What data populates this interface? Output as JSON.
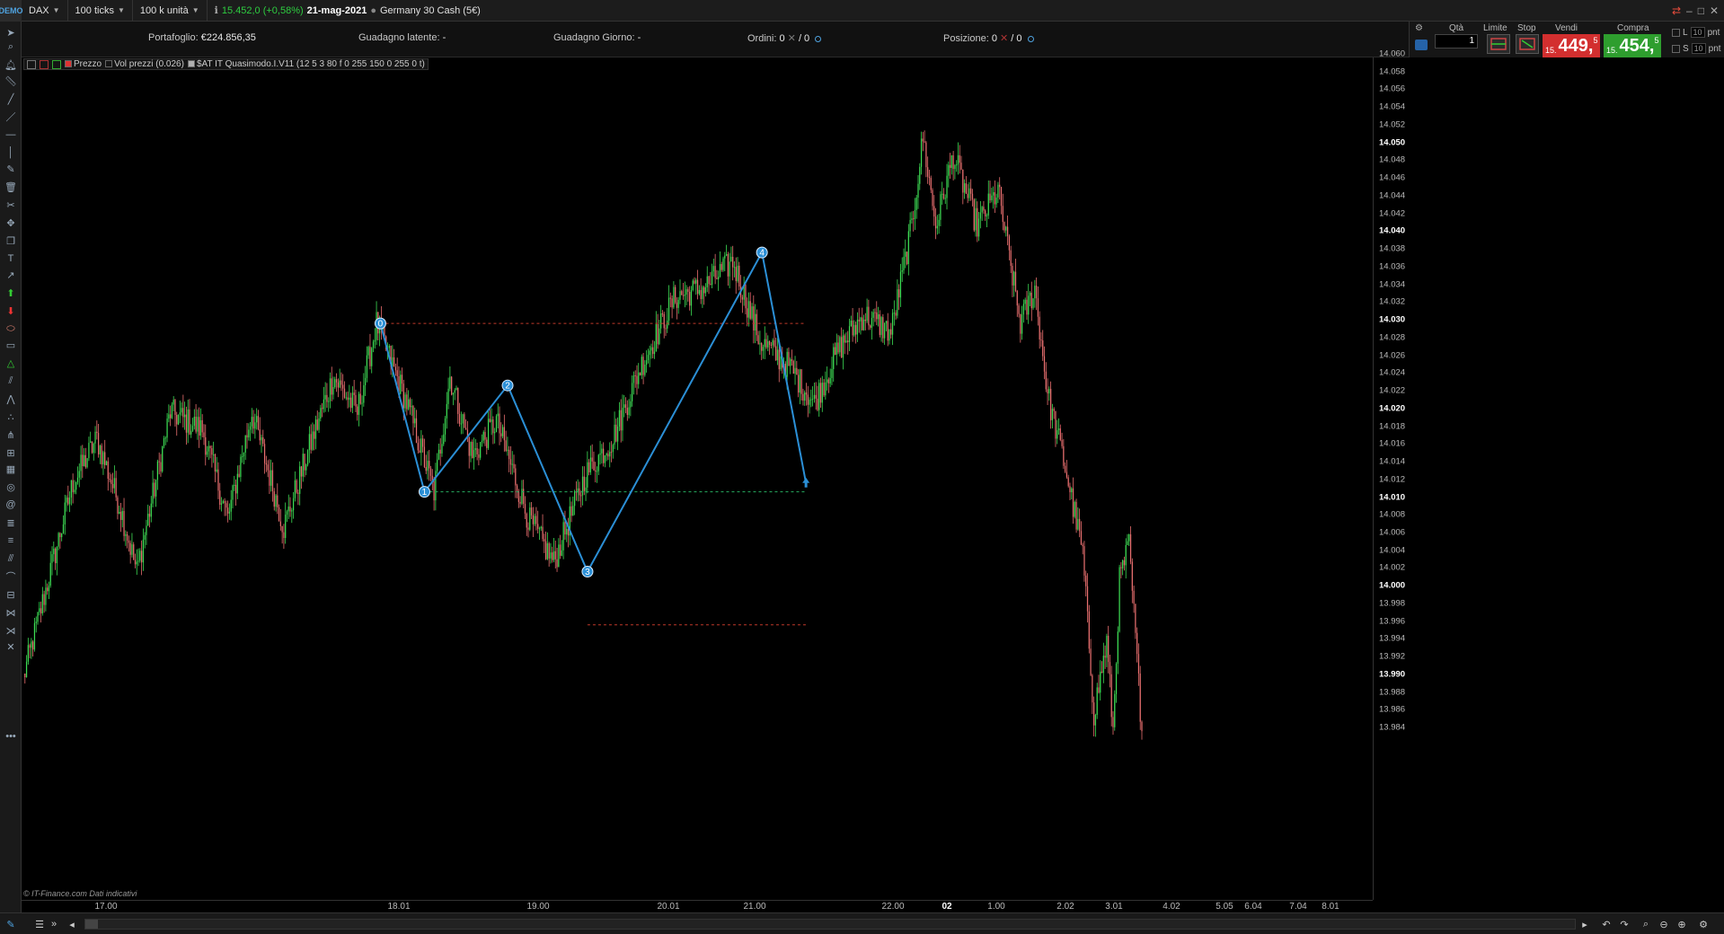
{
  "topbar": {
    "logo": "DEMO",
    "instrument": "DAX",
    "ticks": "100 ticks",
    "units": "100 k unità",
    "price_change": "15.452,0 (+0,58%)",
    "date": "21-mag-2021",
    "market": "Germany 30 Cash (5€)"
  },
  "info": {
    "portfolio_label": "Portafoglio:",
    "portfolio_value": "€224.856,35",
    "unrealized_label": "Guadagno latente:",
    "unrealized_value": "-",
    "daygain_label": "Guadagno Giorno:",
    "daygain_value": "-",
    "orders_label": "Ordini:",
    "orders_value_a": "0",
    "orders_value_b": "/ 0",
    "position_label": "Posizione:",
    "position_value_a": "0",
    "position_value_b": "/ 0"
  },
  "order_panel": {
    "qty_label": "Qtà",
    "qty_value": "1",
    "limit_label": "Limite",
    "stop_label": "Stop",
    "sell_label": "Vendi",
    "buy_label": "Compra",
    "sell_prefix": "15.",
    "sell_main": "449,",
    "sell_sup": "5",
    "buy_prefix": "15.",
    "buy_main": "454,",
    "buy_sup": "5",
    "l_label": "L",
    "s_label": "S",
    "l_value": "10",
    "s_value": "10",
    "unit": "pnt"
  },
  "legend": {
    "price": "Prezzo",
    "volume": "Vol prezzi (0.026)",
    "indicator": "$AT IT Quasimodo.I.V11 (12 5 3 80 f 0 255 150 0 255 0 t)"
  },
  "source": "© IT-Finance.com  Dati indicativi",
  "colors": {
    "bull": "#3ddc54",
    "bear": "#e86f6f",
    "pattern_line": "#2b8fd6",
    "dash_red": "#c0392b",
    "dash_green": "#27ae60"
  },
  "chart_data": {
    "type": "candlestick",
    "ylim": [
      13.983,
      14.06
    ],
    "yticks": [
      "14.060",
      "14.058",
      "14.056",
      "14.054",
      "14.052",
      "14.050",
      "14.048",
      "14.046",
      "14.044",
      "14.042",
      "14.040",
      "14.038",
      "14.036",
      "14.034",
      "14.032",
      "14.030",
      "14.028",
      "14.026",
      "14.024",
      "14.022",
      "14.020",
      "14.018",
      "14.016",
      "14.014",
      "14.012",
      "14.010",
      "14.008",
      "14.006",
      "14.004",
      "14.002",
      "14.000",
      "13.998",
      "13.996",
      "13.994",
      "13.992",
      "13.990",
      "13.988",
      "13.986",
      "13.984"
    ],
    "bold_yticks": [
      "14.050",
      "14.040",
      "14.030",
      "14.020",
      "14.010",
      "14.000",
      "13.990"
    ],
    "xticks": [
      {
        "label": "17.00",
        "bold": false
      },
      {
        "label": "18.01",
        "bold": false
      },
      {
        "label": "19.00",
        "bold": false
      },
      {
        "label": "20.01",
        "bold": false
      },
      {
        "label": "21.00",
        "bold": false
      },
      {
        "label": "22.00",
        "bold": false
      },
      {
        "label": "02",
        "bold": true
      },
      {
        "label": "1.00",
        "bold": false
      },
      {
        "label": "2.02",
        "bold": false
      },
      {
        "label": "3.01",
        "bold": false
      },
      {
        "label": "4.02",
        "bold": false
      },
      {
        "label": "5.05",
        "bold": false
      },
      {
        "label": "6.04",
        "bold": false
      },
      {
        "label": "7.04",
        "bold": false
      },
      {
        "label": "8.01",
        "bold": false
      }
    ],
    "path_anchors": [
      [
        0,
        13.99
      ],
      [
        30,
        14.012
      ],
      [
        45,
        14.017
      ],
      [
        60,
        14.009
      ],
      [
        70,
        14.002
      ],
      [
        90,
        14.02
      ],
      [
        110,
        14.018
      ],
      [
        125,
        14.008
      ],
      [
        140,
        14.02
      ],
      [
        160,
        14.007
      ],
      [
        175,
        14.016
      ],
      [
        190,
        14.024
      ],
      [
        205,
        14.02
      ],
      [
        217,
        14.03
      ],
      [
        235,
        14.021
      ],
      [
        252,
        14.011
      ],
      [
        262,
        14.024
      ],
      [
        275,
        14.015
      ],
      [
        290,
        14.019
      ],
      [
        310,
        14.008
      ],
      [
        325,
        14.003
      ],
      [
        345,
        14.013
      ],
      [
        362,
        14.017
      ],
      [
        378,
        14.025
      ],
      [
        400,
        14.033
      ],
      [
        417,
        14.034
      ],
      [
        435,
        14.037
      ],
      [
        452,
        14.028
      ],
      [
        470,
        14.025
      ],
      [
        485,
        14.021
      ],
      [
        500,
        14.027
      ],
      [
        515,
        14.031
      ],
      [
        532,
        14.029
      ],
      [
        545,
        14.041
      ],
      [
        552,
        14.051
      ],
      [
        560,
        14.041
      ],
      [
        570,
        14.049
      ],
      [
        585,
        14.041
      ],
      [
        598,
        14.045
      ],
      [
        612,
        14.03
      ],
      [
        620,
        14.034
      ],
      [
        628,
        14.022
      ],
      [
        640,
        14.013
      ],
      [
        650,
        14.004
      ],
      [
        657,
        13.986
      ],
      [
        664,
        13.994
      ],
      [
        668,
        13.984
      ],
      [
        672,
        14.001
      ],
      [
        678,
        14.005
      ],
      [
        686,
        13.984
      ]
    ],
    "pattern_points": [
      {
        "label": "0",
        "x": 219,
        "y": 14.03
      },
      {
        "label": "1",
        "x": 246,
        "y": 14.011
      },
      {
        "label": "2",
        "x": 297,
        "y": 14.023
      },
      {
        "label": "3",
        "x": 346,
        "y": 14.002
      },
      {
        "label": "4",
        "x": 453,
        "y": 14.038
      },
      {
        "label": "arrow",
        "x": 480,
        "y": 14.012
      }
    ],
    "levels": [
      {
        "name": "top",
        "y": 14.03,
        "x0": 219,
        "x1": 480,
        "color": "red"
      },
      {
        "name": "mid",
        "y": 14.011,
        "x0": 246,
        "x1": 480,
        "color": "green"
      },
      {
        "name": "low",
        "y": 13.996,
        "x0": 346,
        "x1": 480,
        "color": "red"
      }
    ]
  }
}
